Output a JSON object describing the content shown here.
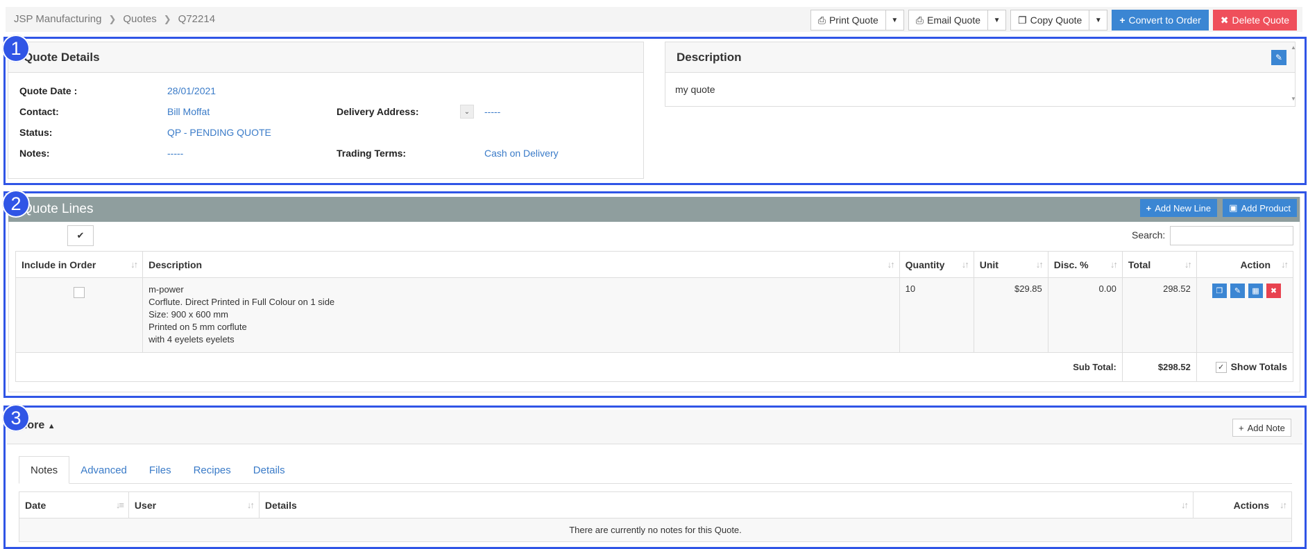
{
  "breadcrumb": {
    "company": "JSP Manufacturing",
    "section": "Quotes",
    "current": "Q72214"
  },
  "toolbar": {
    "print": "Print Quote",
    "email": "Email Quote",
    "copy": "Copy Quote",
    "convert": "Convert to Order",
    "delete": "Delete Quote"
  },
  "badges": {
    "one": "1",
    "two": "2",
    "three": "3"
  },
  "quote_details": {
    "title": "Quote Details",
    "quote_date_label": "Quote Date :",
    "quote_date": "28/01/2021",
    "contact_label": "Contact:",
    "contact": "Bill Moffat",
    "status_label": "Status:",
    "status": "QP - PENDING QUOTE",
    "notes_label": "Notes:",
    "notes": "-----",
    "delivery_label": "Delivery Address:",
    "delivery": "-----",
    "terms_label": "Trading Terms:",
    "terms": "Cash on Delivery"
  },
  "description": {
    "title": "Description",
    "text": "my quote"
  },
  "quote_lines": {
    "title": "Quote Lines",
    "add_line": "Add New Line",
    "add_product": "Add Product",
    "search_label": "Search:",
    "columns": [
      "Include in Order",
      "Description",
      "Quantity",
      "Unit",
      "Disc. %",
      "Total",
      "Action"
    ],
    "rows": [
      {
        "description": [
          "m-power",
          "Corflute. Direct Printed in Full Colour on 1 side",
          "Size: 900 x 600 mm",
          "Printed on 5 mm corflute",
          "with 4 eyelets eyelets"
        ],
        "quantity": "10",
        "unit": "$29.85",
        "disc": "0.00",
        "total": "298.52"
      }
    ],
    "subtotal_label": "Sub Total:",
    "subtotal": "$298.52",
    "show_totals": "Show Totals"
  },
  "more": {
    "title": "More",
    "add_note": "Add Note",
    "tabs": [
      "Notes",
      "Advanced",
      "Files",
      "Recipes",
      "Details"
    ],
    "columns": [
      "Date",
      "User",
      "Details",
      "Actions"
    ],
    "empty": "There are currently no notes for this Quote."
  },
  "colors": {
    "frame": "#3055e6",
    "primary": "#3b86d3",
    "danger": "#ef4f5b",
    "lines_header": "#8f9e9e",
    "link": "#3a7bc8"
  }
}
